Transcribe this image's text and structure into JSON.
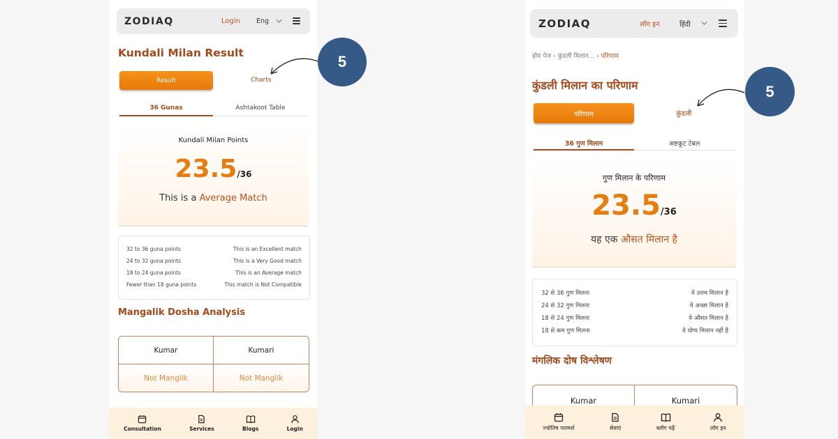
{
  "left": {
    "header": {
      "logo": "ZODIAQ",
      "login": "Login",
      "language": "Eng"
    },
    "title": "Kundali Milan Result",
    "tabs": {
      "result": "Result",
      "charts": "Charts"
    },
    "subtabs": {
      "gunas": "36 Gunas",
      "ashtakoot": "Ashtakoot Table"
    },
    "points": {
      "label": "Kundali Milan Points",
      "score": "23.5",
      "max": "/36",
      "match_prefix": "This is a ",
      "match_highlight": "Average Match"
    },
    "legend": [
      {
        "range": "32 to 36 guna points",
        "desc": "This is an Excellent match"
      },
      {
        "range": "24 to 32 guna points",
        "desc": "This is a Very Good match"
      },
      {
        "range": "18 to 24 guna points",
        "desc": "This is an Average match"
      },
      {
        "range": "Fewer than 18 guna points",
        "desc": "This match is Not Compatible"
      }
    ],
    "manglik": {
      "title": "Mangalik Dosha Analysis",
      "headers": [
        "Kumar",
        "Kumari"
      ],
      "values": [
        "Not Manglik",
        "Not Manglik"
      ]
    },
    "bottom_nav": [
      "Consultation",
      "Services",
      "Blogs",
      "Login"
    ]
  },
  "right": {
    "header": {
      "logo": "ZODIAQ",
      "login": "लॉग इन",
      "language": "हिंदी"
    },
    "breadcrumb": {
      "home": "होम पेज",
      "sep1": " › ",
      "mid": "कुंडली मिलान...",
      "sep2": " › ",
      "current": "परिणाम"
    },
    "title": "कुंडली मिलान का परिणाम",
    "tabs": {
      "result": "परिणाम",
      "charts": "कुंडली"
    },
    "subtabs": {
      "gunas": "36 गुण मिलान",
      "ashtakoot": "अष्टकूट टेबल"
    },
    "points": {
      "label": "गुण मिलान के परिणाम",
      "score": "23.5",
      "max": "/36",
      "match_prefix": "यह एक ",
      "match_highlight": "औसत मिलान है"
    },
    "legend": [
      {
        "range": "32 से 36 गुण मिलना",
        "desc": "ये उत्तम मिलान है"
      },
      {
        "range": "24 से 32 गुण मिलना",
        "desc": "ये अच्छा मिलान है"
      },
      {
        "range": "18 से 24 गुण मिलना",
        "desc": "ये औसत मिलान है"
      },
      {
        "range": "18 से कम गुण मिलना",
        "desc": "ये योग्य मिलान नहीं है"
      }
    ],
    "manglik": {
      "title": "मंगलिक दोष विश्लेषण",
      "headers": [
        "Kumar",
        "Kumari"
      ]
    },
    "bottom_nav": [
      "ज्योतिष परामर्श",
      "सेवाएं",
      "ब्लॉग पढ़ें",
      "लॉग इन"
    ]
  },
  "callouts": {
    "left": "5",
    "right": "5"
  },
  "colors": {
    "accent": "#e57d10",
    "brown": "#a14a1c",
    "badge": "#365a88",
    "nav_bg": "#fdf0dc"
  }
}
